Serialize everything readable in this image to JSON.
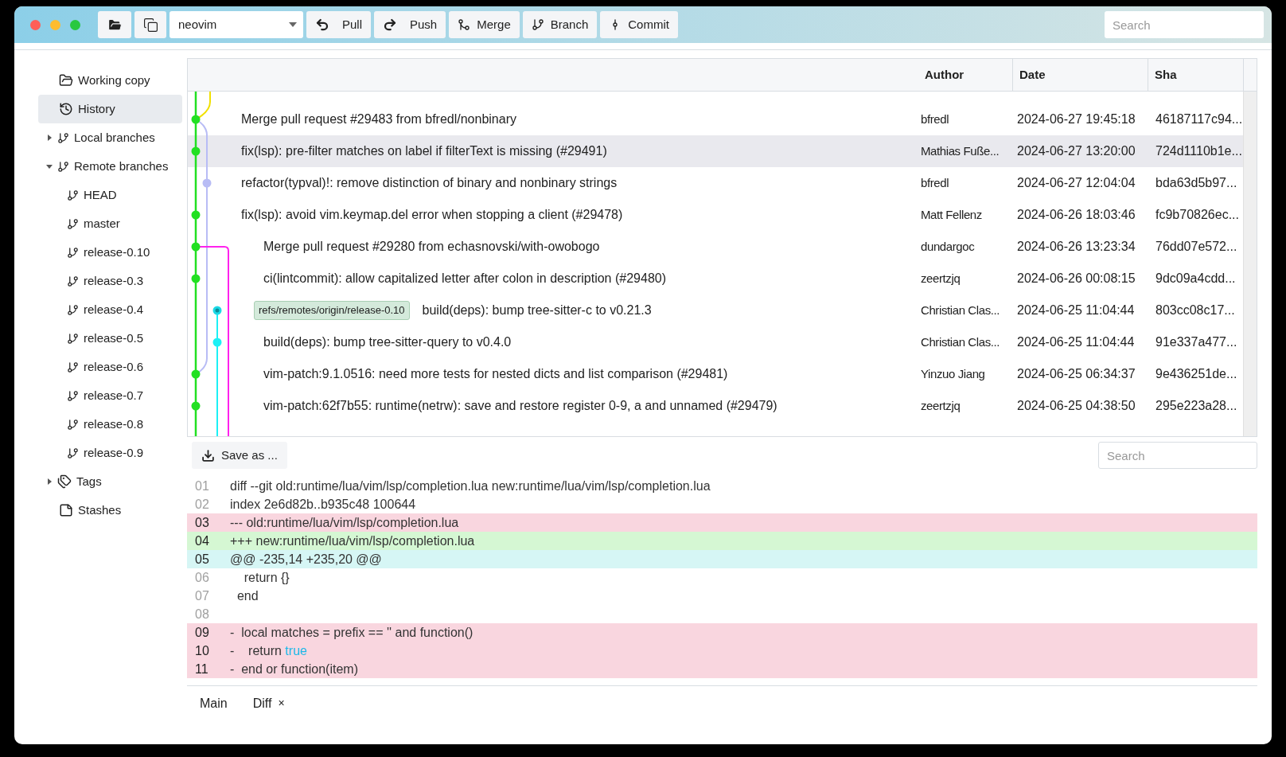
{
  "toolbar": {
    "repository": "neovim",
    "buttons": [
      {
        "label": "Pull",
        "kind": "pull"
      },
      {
        "label": "Push",
        "kind": "push"
      },
      {
        "label": "Merge",
        "kind": "merge"
      },
      {
        "label": "Branch",
        "kind": "branch"
      },
      {
        "label": "Commit",
        "kind": "commit"
      }
    ],
    "search": {
      "placeholder": "Search"
    }
  },
  "sidebar": {
    "items": [
      {
        "label": "Working copy",
        "kind": "folder",
        "selected": false
      },
      {
        "label": "History",
        "kind": "history",
        "selected": true
      },
      {
        "label": "Local branches",
        "kind": "branch",
        "selected": false,
        "expanded": false
      },
      {
        "label": "Remote branches",
        "kind": "branch",
        "selected": false,
        "expanded": true,
        "children": [
          {
            "label": "HEAD",
            "kind": "branch",
            "selected": false
          },
          {
            "label": "master",
            "kind": "branch",
            "selected": false
          },
          {
            "label": "release-0.10",
            "kind": "branch",
            "selected": false
          },
          {
            "label": "release-0.3",
            "kind": "branch",
            "selected": false
          },
          {
            "label": "release-0.4",
            "kind": "branch",
            "selected": false
          },
          {
            "label": "release-0.5",
            "kind": "branch",
            "selected": false
          },
          {
            "label": "release-0.6",
            "kind": "branch",
            "selected": false
          },
          {
            "label": "release-0.7",
            "kind": "branch",
            "selected": false
          },
          {
            "label": "release-0.8",
            "kind": "branch",
            "selected": false
          },
          {
            "label": "release-0.9",
            "kind": "branch",
            "selected": false
          }
        ]
      },
      {
        "label": "Tags",
        "kind": "tag",
        "selected": false,
        "expanded": false
      },
      {
        "label": "Stashes",
        "kind": "stash",
        "selected": false
      }
    ]
  },
  "history": {
    "columns": [
      "Author",
      "Date",
      "Sha"
    ],
    "rows": [
      {
        "message": "Merge pull request #29483 from bfredl/nonbinary",
        "author": "bfredl",
        "date": "2024-06-27 19:45:18",
        "sha": "46187117c94...",
        "selected": false
      },
      {
        "message": "fix(lsp): pre-filter matches on label if filterText is missing (#29491)",
        "author": "Mathias Fuße...",
        "date": "2024-06-27 13:20:00",
        "sha": "724d1110b1e...",
        "selected": true
      },
      {
        "message": "refactor(typval)!: remove distinction of binary and nonbinary strings",
        "author": "bfredl",
        "date": "2024-06-27 12:04:04",
        "sha": "bda63d5b97...",
        "selected": false
      },
      {
        "message": "fix(lsp): avoid vim.keymap.del error when stopping a client (#29478)",
        "author": "Matt Fellenz",
        "date": "2024-06-26 18:03:46",
        "sha": "fc9b70826ec...",
        "selected": false
      },
      {
        "message": "Merge pull request #29280 from echasnovski/with-owobogo",
        "author": "dundargoc",
        "date": "2024-06-26 13:23:34",
        "sha": "76dd07e572...",
        "selected": false
      },
      {
        "message": "ci(lintcommit): allow capitalized letter after colon in description (#29480)",
        "author": "zeertzjq",
        "date": "2024-06-26 00:08:15",
        "sha": "9dc09a4cdd...",
        "selected": false
      },
      {
        "ref": "refs/remotes/origin/release-0.10",
        "message": "build(deps): bump tree-sitter-c to v0.21.3",
        "author": "Christian Clas...",
        "date": "2024-06-25 11:04:44",
        "sha": "803cc08c17...",
        "selected": false
      },
      {
        "message": "build(deps): bump tree-sitter-query to v0.4.0",
        "author": "Christian Clas...",
        "date": "2024-06-25 11:04:44",
        "sha": "91e337a477...",
        "selected": false
      },
      {
        "message": "vim-patch:9.1.0516: need more tests for nested dicts and list comparison (#29481)",
        "author": "Yinzuo Jiang",
        "date": "2024-06-25 06:34:37",
        "sha": "9e436251de...",
        "selected": false
      },
      {
        "message": "vim-patch:62f7b55: runtime(netrw): save and restore register 0-9, a and unnamed (#29479)",
        "author": "zeertzjq",
        "date": "2024-06-25 04:38:50",
        "sha": "295e223a28...",
        "selected": false
      }
    ]
  },
  "diff": {
    "save_button": "Save as ...",
    "search": {
      "placeholder": "Search"
    },
    "lines": [
      {
        "number": "01",
        "kind": "header",
        "parts": [
          {
            "text": "diff --git old:runtime/lua/vim/lsp/completion.lua new:runtime/lua/vim/lsp/completion.lua",
            "kind": "plain"
          }
        ]
      },
      {
        "number": "02",
        "kind": "header",
        "parts": [
          {
            "text": "index 2e6d82b..b935c48 100644",
            "kind": "plain"
          }
        ]
      },
      {
        "number": "03",
        "kind": "removed",
        "parts": [
          {
            "text": "--- old:runtime/lua/vim/lsp/completion.lua",
            "kind": "plain"
          }
        ]
      },
      {
        "number": "04",
        "kind": "added",
        "parts": [
          {
            "text": "+++ new:runtime/lua/vim/lsp/completion.lua",
            "kind": "plain"
          }
        ]
      },
      {
        "number": "05",
        "kind": "hunk",
        "parts": [
          {
            "text": "@@ -235,14 +235,20 @@",
            "kind": "plain"
          }
        ]
      },
      {
        "number": "06",
        "kind": "context",
        "parts": [
          {
            "text": "    return {}",
            "kind": "plain"
          }
        ]
      },
      {
        "number": "07",
        "kind": "context",
        "parts": [
          {
            "text": "  end",
            "kind": "plain"
          }
        ]
      },
      {
        "number": "08",
        "kind": "context"
      },
      {
        "number": "09",
        "kind": "removed",
        "parts": [
          {
            "text": "-  local matches = prefix == '' and function()",
            "kind": "plain"
          }
        ]
      },
      {
        "number": "10",
        "kind": "removed",
        "parts": [
          {
            "text": "-    return ",
            "kind": "plain"
          },
          {
            "text": "true",
            "kind": "keyword"
          }
        ]
      },
      {
        "number": "11",
        "kind": "removed",
        "parts": [
          {
            "text": "-  end or function(item)",
            "kind": "plain"
          }
        ]
      }
    ]
  },
  "bottom_tabs": [
    {
      "label": "Main"
    },
    {
      "label": "Diff",
      "close": "×"
    }
  ]
}
